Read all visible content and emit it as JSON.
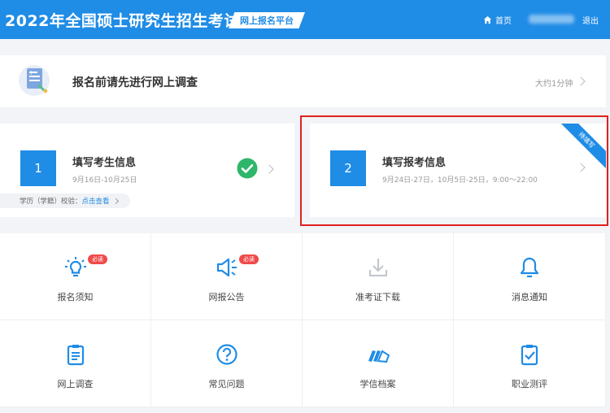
{
  "header": {
    "title": "2022年全国硕士研究生招生考试",
    "platform": "网上报名平台",
    "home_label": "首页",
    "logout_label": "退出",
    "bg_color": "#1f8ce6"
  },
  "survey": {
    "title": "报名前请先进行网上调查",
    "time": "大约1分钟",
    "icon": "document-icon"
  },
  "steps": [
    {
      "number": "1",
      "title": "填写考生信息",
      "date": "9月16日-10月25日",
      "status_icon": "check-circle-icon",
      "verify_prefix": "学历（学籍）校验：",
      "verify_link": "点击查看"
    },
    {
      "number": "2",
      "title": "填写报考信息",
      "date": "9月24日-27日，10月5日-25日，9:00～22:00",
      "ribbon": "待填写"
    }
  ],
  "tiles": [
    {
      "label": "报名须知",
      "icon": "lightbulb-icon",
      "badge": "必读"
    },
    {
      "label": "网报公告",
      "icon": "megaphone-icon",
      "badge": "必读"
    },
    {
      "label": "准考证下载",
      "icon": "download-icon"
    },
    {
      "label": "消息通知",
      "icon": "bell-icon"
    },
    {
      "label": "网上调查",
      "icon": "clipboard-icon"
    },
    {
      "label": "常见问题",
      "icon": "question-icon"
    },
    {
      "label": "学信档案",
      "icon": "books-icon"
    },
    {
      "label": "职业测评",
      "icon": "clipboard-check-icon"
    }
  ],
  "colors": {
    "accent": "#1f8ce6",
    "success": "#2eb66a",
    "badge": "#f04a4a",
    "highlight": "#e02020"
  }
}
